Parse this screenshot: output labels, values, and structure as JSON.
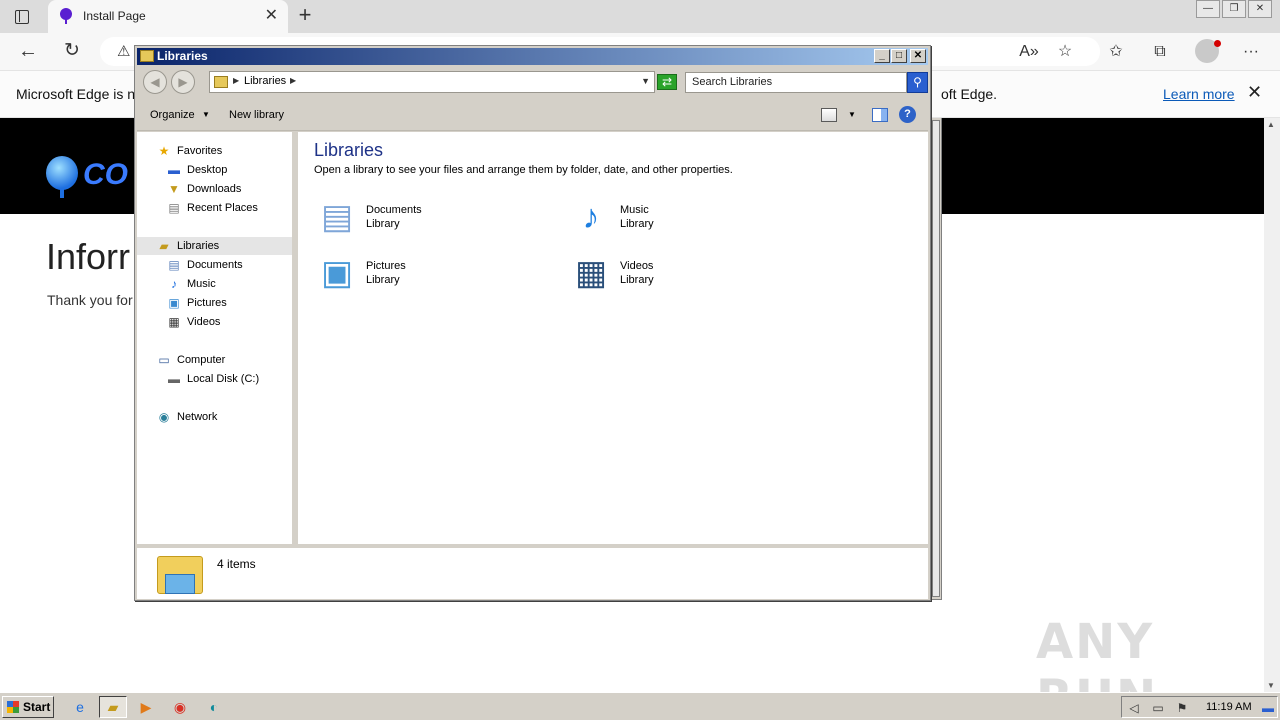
{
  "browser": {
    "tab_title": "Install Page",
    "tab_close": "✕",
    "new_tab": "+",
    "window_controls": [
      "—",
      "❐",
      "✕"
    ],
    "infobar": {
      "left_text": "Microsoft Edge is no",
      "right_text": "oft Edge.",
      "learn_more": "Learn more",
      "close": "✕"
    }
  },
  "page": {
    "logo_text": "CO",
    "heading": "Inforr",
    "body_text": "Thank you for"
  },
  "explorer": {
    "title": "Libraries",
    "title_buttons": [
      "_",
      "□",
      "✕"
    ],
    "breadcrumb_label": "Libraries",
    "search_placeholder": "Search Libraries",
    "commands": {
      "organize": "Organize",
      "new_library": "New library",
      "help": "?"
    },
    "nav": {
      "favorites": "Favorites",
      "desktop": "Desktop",
      "downloads": "Downloads",
      "recent_places": "Recent Places",
      "libraries": "Libraries",
      "documents": "Documents",
      "music": "Music",
      "pictures": "Pictures",
      "videos": "Videos",
      "computer": "Computer",
      "local_disk": "Local Disk (C:)",
      "network": "Network"
    },
    "content_title": "Libraries",
    "content_subtitle": "Open a library to see your files and arrange them by folder, date, and other properties.",
    "libraries": [
      {
        "name": "Documents",
        "type": "Library"
      },
      {
        "name": "Music",
        "type": "Library"
      },
      {
        "name": "Pictures",
        "type": "Library"
      },
      {
        "name": "Videos",
        "type": "Library"
      }
    ],
    "status": "4 items"
  },
  "taskbar": {
    "start_label": "Start",
    "clock": "11:19 AM"
  },
  "watermark": "ANY RUN"
}
